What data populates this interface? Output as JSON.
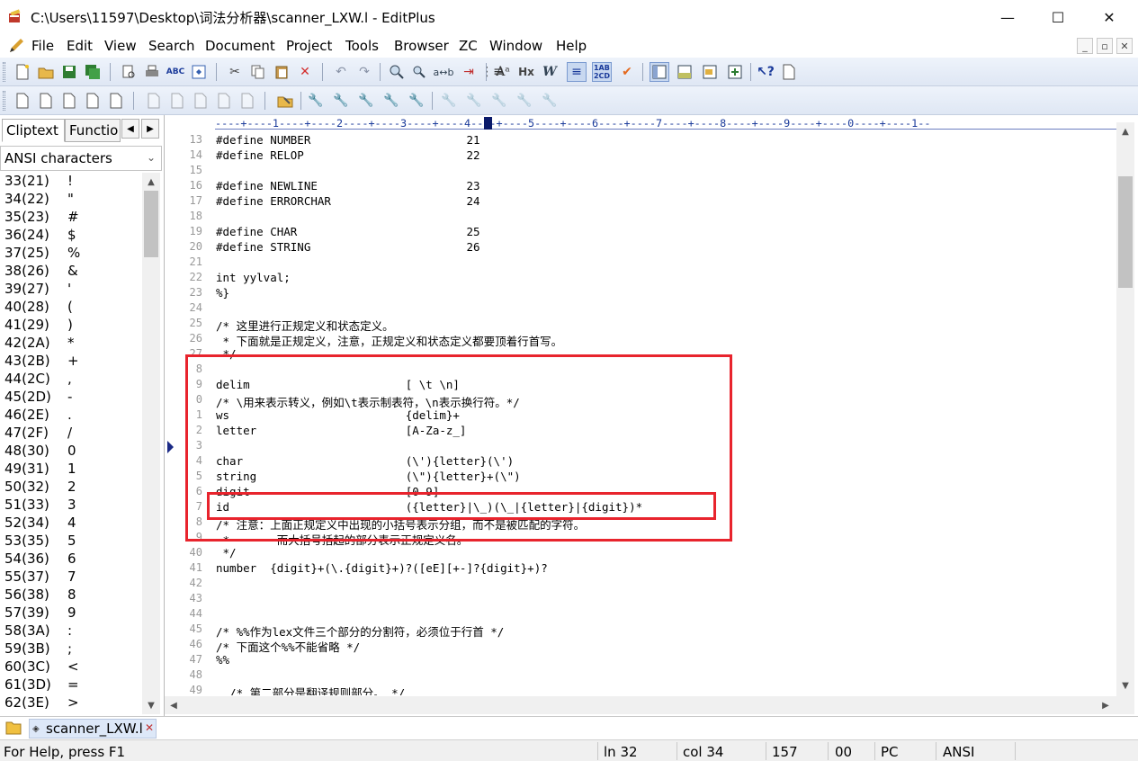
{
  "window": {
    "title": "C:\\Users\\11597\\Desktop\\词法分析器\\scanner_LXW.l - EditPlus",
    "minimize_glyph": "—",
    "maximize_glyph": "☐",
    "close_glyph": "✕"
  },
  "menu": {
    "items": [
      "File",
      "Edit",
      "View",
      "Search",
      "Document",
      "Project",
      "Tools",
      "Browser",
      "ZC",
      "Window",
      "Help"
    ],
    "mdi_buttons": [
      "_",
      "▫",
      "✕"
    ]
  },
  "left_panel": {
    "tabs": [
      "Cliptext",
      "Functio"
    ],
    "combo_value": "ANSI characters",
    "chars": [
      {
        "code": "33(21)",
        "glyph": "!"
      },
      {
        "code": "34(22)",
        "glyph": "\""
      },
      {
        "code": "35(23)",
        "glyph": "#"
      },
      {
        "code": "36(24)",
        "glyph": "$"
      },
      {
        "code": "37(25)",
        "glyph": "%"
      },
      {
        "code": "38(26)",
        "glyph": "&"
      },
      {
        "code": "39(27)",
        "glyph": "'"
      },
      {
        "code": "40(28)",
        "glyph": "("
      },
      {
        "code": "41(29)",
        "glyph": ")"
      },
      {
        "code": "42(2A)",
        "glyph": "*"
      },
      {
        "code": "43(2B)",
        "glyph": "+"
      },
      {
        "code": "44(2C)",
        "glyph": ","
      },
      {
        "code": "45(2D)",
        "glyph": "-"
      },
      {
        "code": "46(2E)",
        "glyph": "."
      },
      {
        "code": "47(2F)",
        "glyph": "/"
      },
      {
        "code": "48(30)",
        "glyph": "0"
      },
      {
        "code": "49(31)",
        "glyph": "1"
      },
      {
        "code": "50(32)",
        "glyph": "2"
      },
      {
        "code": "51(33)",
        "glyph": "3"
      },
      {
        "code": "52(34)",
        "glyph": "4"
      },
      {
        "code": "53(35)",
        "glyph": "5"
      },
      {
        "code": "54(36)",
        "glyph": "6"
      },
      {
        "code": "55(37)",
        "glyph": "7"
      },
      {
        "code": "56(38)",
        "glyph": "8"
      },
      {
        "code": "57(39)",
        "glyph": "9"
      },
      {
        "code": "58(3A)",
        "glyph": ":"
      },
      {
        "code": "59(3B)",
        "glyph": ";"
      },
      {
        "code": "60(3C)",
        "glyph": "<"
      },
      {
        "code": "61(3D)",
        "glyph": "="
      },
      {
        "code": "62(3E)",
        "glyph": ">"
      }
    ]
  },
  "editor": {
    "ruler": "----+----1----+----2----+----3----+----4----+----5----+----6----+----7----+----8----+----9----+----0----+----1--",
    "lines": [
      {
        "num": "13",
        "text": "#define NUMBER                       21"
      },
      {
        "num": "14",
        "text": "#define RELOP                        22"
      },
      {
        "num": "15",
        "text": ""
      },
      {
        "num": "16",
        "text": "#define NEWLINE                      23"
      },
      {
        "num": "17",
        "text": "#define ERRORCHAR                    24"
      },
      {
        "num": "18",
        "text": ""
      },
      {
        "num": "19",
        "text": "#define CHAR                         25"
      },
      {
        "num": "20",
        "text": "#define STRING                       26"
      },
      {
        "num": "21",
        "text": ""
      },
      {
        "num": "22",
        "text": "int yylval;"
      },
      {
        "num": "23",
        "text": "%}"
      },
      {
        "num": "24",
        "text": ""
      },
      {
        "num": "25",
        "text": "/* 这里进行正规定义和状态定义。"
      },
      {
        "num": "26",
        "text": " * 下面就是正规定义，注意，正规定义和状态定义都要顶着行首写。"
      },
      {
        "num": "27",
        "text": " */"
      },
      {
        "num": "8",
        "text": ""
      },
      {
        "num": "9",
        "text": "delim                       [ \\t \\n]"
      },
      {
        "num": "0",
        "text": "/* \\用来表示转义，例如\\t表示制表符，\\n表示换行符。*/"
      },
      {
        "num": "1",
        "text": "ws                          {delim}+"
      },
      {
        "num": "2",
        "text": "letter                      [A-Za-z_]"
      },
      {
        "num": "3",
        "text": ""
      },
      {
        "num": "4",
        "text": "char                        (\\'){letter}(\\')"
      },
      {
        "num": "5",
        "text": "string                      (\\\"){letter}+(\\\")"
      },
      {
        "num": "6",
        "text": "digit                       [0-9]"
      },
      {
        "num": "7",
        "text": "id                          ({letter}|\\_)(\\_|{letter}|{digit})*"
      },
      {
        "num": "8",
        "text": "/* 注意：上面正规定义中出现的小括号表示分组，而不是被匹配的字符。"
      },
      {
        "num": "9",
        "text": " *       而大括号括起的部分表示正规定义名。"
      },
      {
        "num": "40",
        "text": " */"
      },
      {
        "num": "41",
        "text": "number  {digit}+(\\.{digit}+)?([eE][+-]?{digit}+)?"
      },
      {
        "num": "42",
        "text": ""
      },
      {
        "num": "43",
        "text": ""
      },
      {
        "num": "44",
        "text": ""
      },
      {
        "num": "45",
        "text": "/* %%作为lex文件三个部分的分割符，必须位于行首 */"
      },
      {
        "num": "46",
        "text": "/* 下面这个%%不能省略 */"
      },
      {
        "num": "47",
        "text": "%%"
      },
      {
        "num": "48",
        "text": ""
      },
      {
        "num": "49",
        "text": "  /* 第二部分是翻译规则部分。 */"
      }
    ]
  },
  "doc_tabs": {
    "active": "scanner_LXW.l",
    "close_glyph": "✕"
  },
  "status": {
    "help": "For Help, press F1",
    "line": "ln 32",
    "col": "col 34",
    "offset": "157",
    "code": "00",
    "eol": "PC",
    "encoding": "ANSI"
  },
  "colors": {
    "annotation_red": "#e8242d",
    "ruler_blue": "#1a3a9a"
  }
}
